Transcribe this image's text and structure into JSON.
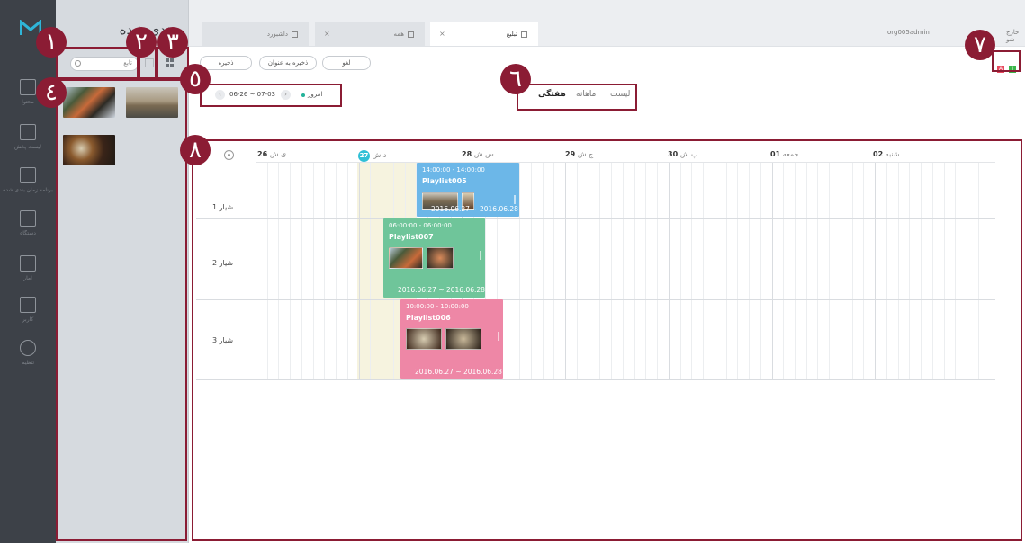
{
  "panel": {
    "title": "بندی شده",
    "search_placeholder": "تابع"
  },
  "rail": {
    "items": [
      "محتوا",
      "لیست پخش",
      "برنامه زمان بندی شده",
      "دستگاه",
      "آمار",
      "کاربر",
      "تنظیم"
    ]
  },
  "tabs": [
    {
      "label": "داشبورد",
      "closable": false
    },
    {
      "label": "همه",
      "closable": true
    },
    {
      "label": "تبلیغ",
      "closable": true,
      "active": true
    }
  ],
  "header": {
    "user": "org005admin",
    "logout": "خارج شو"
  },
  "toolbar": {
    "cancel": "لغو",
    "save_as": "ذخیره به عنوان",
    "save": "ذخیره"
  },
  "flags": [
    {
      "letter": "A",
      "color": "#e84a5f"
    },
    {
      "letter": "I",
      "color": "#3bb54a"
    }
  ],
  "date_range": {
    "range": "06-26 ~ 07-03",
    "today_label": "امروز"
  },
  "view_switch": {
    "list": "لیست",
    "monthly": "ماهانه",
    "weekly": "هفتگی"
  },
  "calendar": {
    "days": [
      {
        "num": "26",
        "name": "ی.ش"
      },
      {
        "num": "27",
        "name": "د.ش",
        "today": true
      },
      {
        "num": "28",
        "name": "س.ش"
      },
      {
        "num": "29",
        "name": "چ.ش"
      },
      {
        "num": "30",
        "name": "پ.ش"
      },
      {
        "num": "01",
        "name": "جمعه"
      },
      {
        "num": "02",
        "name": "شنبه"
      }
    ],
    "rows": [
      "شیار 1",
      "شیار 2",
      "شیار 3"
    ],
    "events": [
      {
        "time": "14:00:00 - 14:00:00",
        "name": "Playlist005",
        "dates": "2016.06.27 ~ 2016.06.28",
        "color": "#6cb7e8"
      },
      {
        "time": "06:00:00 - 06:00:00",
        "name": "Playlist007",
        "dates": "2016.06.27 ~ 2016.06.28",
        "color": "#6fc59a"
      },
      {
        "time": "10:00:00 - 10:00:00",
        "name": "Playlist006",
        "dates": "2016.06.27 ~ 2016.06.28",
        "color": "#ee87a6"
      }
    ]
  },
  "annotations": [
    "١",
    "٢",
    "٣",
    "٤",
    "٥",
    "٦",
    "٧",
    "٨"
  ],
  "colors": {
    "annotation": "#8b1c34",
    "rail": "#3d4148",
    "panel": "#d6dadf",
    "today_column": "#f6f3df",
    "today_badge": "#31c0d6"
  }
}
